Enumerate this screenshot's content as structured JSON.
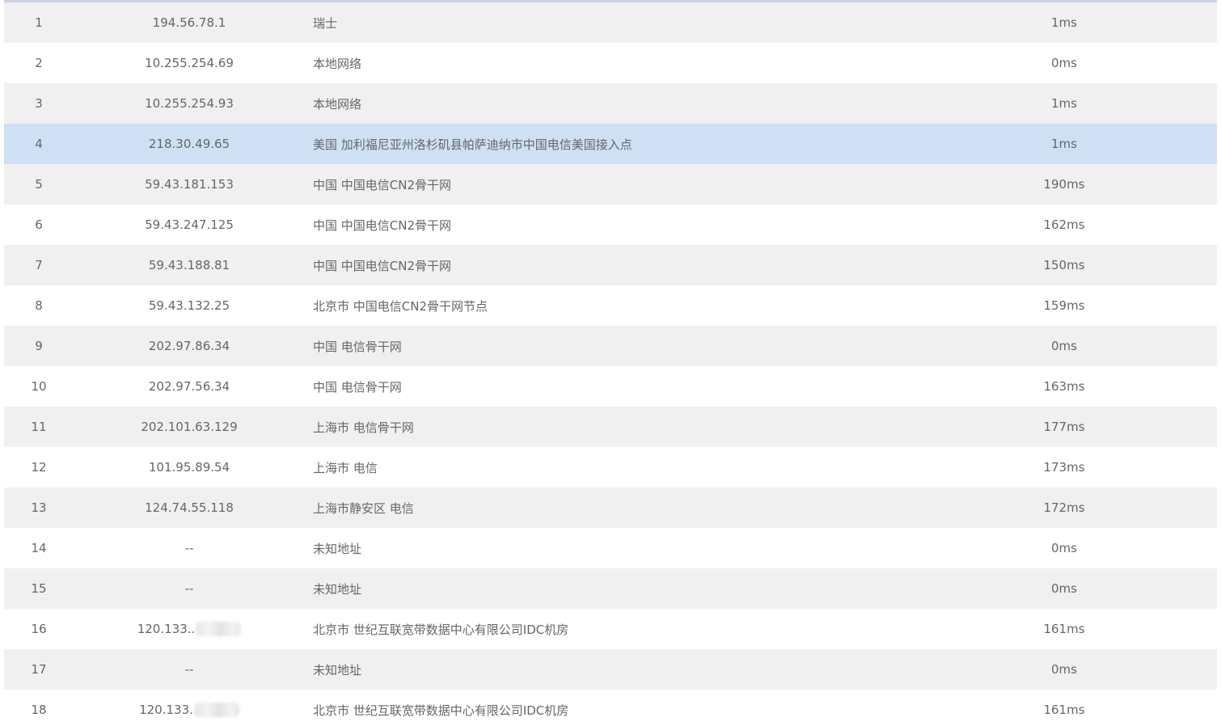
{
  "trace": {
    "rows": [
      {
        "hop": "1",
        "ip": "194.56.78.1",
        "location": "瑞士",
        "rtt": "1ms",
        "highlight": false,
        "masked": false
      },
      {
        "hop": "2",
        "ip": "10.255.254.69",
        "location": "本地网络",
        "rtt": "0ms",
        "highlight": false,
        "masked": false
      },
      {
        "hop": "3",
        "ip": "10.255.254.93",
        "location": "本地网络",
        "rtt": "1ms",
        "highlight": false,
        "masked": false
      },
      {
        "hop": "4",
        "ip": "218.30.49.65",
        "location": "美国 加利福尼亚州洛杉矶县帕萨迪纳市中国电信美国接入点",
        "rtt": "1ms",
        "highlight": true,
        "masked": false
      },
      {
        "hop": "5",
        "ip": "59.43.181.153",
        "location": "中国 中国电信CN2骨干网",
        "rtt": "190ms",
        "highlight": false,
        "masked": false
      },
      {
        "hop": "6",
        "ip": "59.43.247.125",
        "location": "中国 中国电信CN2骨干网",
        "rtt": "162ms",
        "highlight": false,
        "masked": false
      },
      {
        "hop": "7",
        "ip": "59.43.188.81",
        "location": "中国 中国电信CN2骨干网",
        "rtt": "150ms",
        "highlight": false,
        "masked": false
      },
      {
        "hop": "8",
        "ip": "59.43.132.25",
        "location": "北京市 中国电信CN2骨干网节点",
        "rtt": "159ms",
        "highlight": false,
        "masked": false
      },
      {
        "hop": "9",
        "ip": "202.97.86.34",
        "location": "中国 电信骨干网",
        "rtt": "0ms",
        "highlight": false,
        "masked": false
      },
      {
        "hop": "10",
        "ip": "202.97.56.34",
        "location": "中国 电信骨干网",
        "rtt": "163ms",
        "highlight": false,
        "masked": false
      },
      {
        "hop": "11",
        "ip": "202.101.63.129",
        "location": "上海市 电信骨干网",
        "rtt": "177ms",
        "highlight": false,
        "masked": false
      },
      {
        "hop": "12",
        "ip": "101.95.89.54",
        "location": "上海市 电信",
        "rtt": "173ms",
        "highlight": false,
        "masked": false
      },
      {
        "hop": "13",
        "ip": "124.74.55.118",
        "location": "上海市静安区 电信",
        "rtt": "172ms",
        "highlight": false,
        "masked": false
      },
      {
        "hop": "14",
        "ip": "--",
        "location": "未知地址",
        "rtt": "0ms",
        "highlight": false,
        "masked": false
      },
      {
        "hop": "15",
        "ip": "--",
        "location": "未知地址",
        "rtt": "0ms",
        "highlight": false,
        "masked": false
      },
      {
        "hop": "16",
        "ip": "120.133..",
        "location": "北京市 世纪互联宽带数据中心有限公司IDC机房",
        "rtt": "161ms",
        "highlight": false,
        "masked": true
      },
      {
        "hop": "17",
        "ip": "--",
        "location": "未知地址",
        "rtt": "0ms",
        "highlight": false,
        "masked": false
      },
      {
        "hop": "18",
        "ip": "120.133.",
        "location": "北京市 世纪互联宽带数据中心有限公司IDC机房",
        "rtt": "161ms",
        "highlight": false,
        "masked": true
      }
    ]
  },
  "colors": {
    "row_even": "#f0f0f0",
    "row_odd": "#ffffff",
    "row_highlight": "#cfe0f5",
    "text": "#666666",
    "top_border": "#c9d3e3"
  }
}
